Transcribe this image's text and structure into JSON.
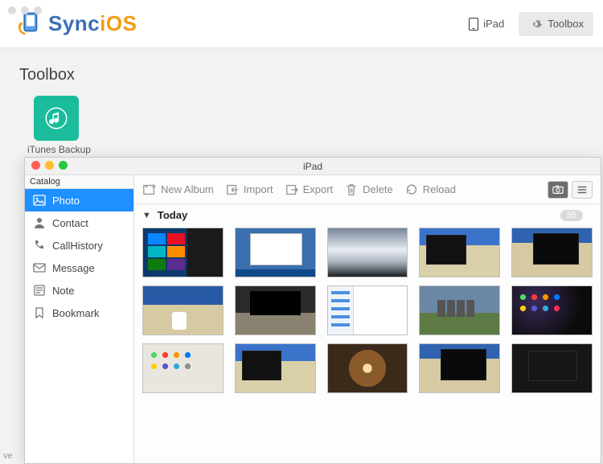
{
  "app": {
    "name_part1": "Sync",
    "name_part2": "iOS"
  },
  "header": {
    "device_label": "iPad",
    "toolbox_label": "Toolbox"
  },
  "page": {
    "title": "Toolbox"
  },
  "tiles": {
    "itunes_backup": "iTunes Backup"
  },
  "child_window": {
    "title": "iPad",
    "sidebar": {
      "header": "Catalog",
      "items": [
        {
          "id": "photo",
          "label": "Photo",
          "icon": "photo-icon",
          "active": true
        },
        {
          "id": "contact",
          "label": "Contact",
          "icon": "contact-icon",
          "active": false
        },
        {
          "id": "callhistory",
          "label": "CallHistory",
          "icon": "call-icon",
          "active": false
        },
        {
          "id": "message",
          "label": "Message",
          "icon": "message-icon",
          "active": false
        },
        {
          "id": "note",
          "label": "Note",
          "icon": "note-icon",
          "active": false
        },
        {
          "id": "bookmark",
          "label": "Bookmark",
          "icon": "bookmark-icon",
          "active": false
        }
      ]
    },
    "toolbar": {
      "new_album": "New Album",
      "import": "Import",
      "export": "Export",
      "delete": "Delete",
      "reload": "Reload"
    },
    "section": {
      "label": "Today",
      "count": "35"
    },
    "thumbnails": [
      {
        "name": "windows-start-menu",
        "style": "th-start"
      },
      {
        "name": "windows-desktop",
        "style": "th-desktop"
      },
      {
        "name": "clouds-aerial",
        "style": "th-clouds"
      },
      {
        "name": "office-monitor-1",
        "style": "th-office1"
      },
      {
        "name": "office-monitor-2",
        "style": "th-office2"
      },
      {
        "name": "desk-cup",
        "style": "th-cup"
      },
      {
        "name": "office-monitor-3",
        "style": "th-bench"
      },
      {
        "name": "ios-settings",
        "style": "th-settings"
      },
      {
        "name": "stonehenge",
        "style": "th-stone"
      },
      {
        "name": "ipad-home-dark-1",
        "style": "th-ipad1"
      },
      {
        "name": "ipad-home-light",
        "style": "th-ipad2-light"
      },
      {
        "name": "office-monitor-4",
        "style": "th-office1"
      },
      {
        "name": "tunnel-perspective",
        "style": "th-tunnel"
      },
      {
        "name": "office-monitor-5",
        "style": "th-office2"
      },
      {
        "name": "dark-screen",
        "style": "th-dark"
      }
    ]
  },
  "footer": {
    "version_prefix": "ve"
  }
}
